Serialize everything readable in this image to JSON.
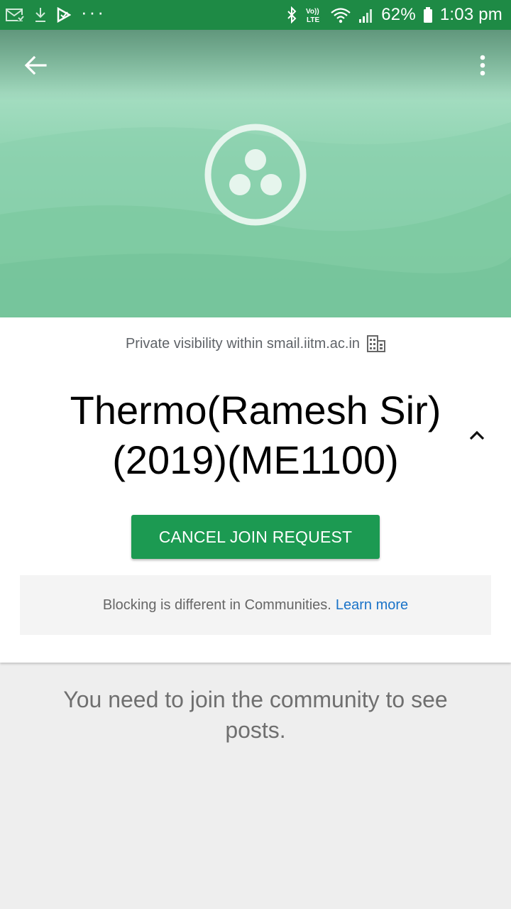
{
  "status_bar": {
    "battery": "62%",
    "time": "1:03 pm",
    "network_label": "Vo)) LTE",
    "left_icons": [
      "mail-icon",
      "download-icon",
      "play-store-icon",
      "more-notifications-icon"
    ],
    "right_icons": [
      "bluetooth-icon",
      "volte-icon",
      "wifi-icon",
      "signal-icon",
      "battery-icon"
    ]
  },
  "header": {
    "back_icon": "arrow-back-icon",
    "menu_icon": "more-vert-icon",
    "logo_icon": "community-icon"
  },
  "community": {
    "visibility_text": "Private visibility within smail.iitm.ac.in",
    "visibility_icon": "domain-building-icon",
    "title_line1": "Thermo(Ramesh Sir)",
    "title_line2": "(2019)(ME1100)",
    "collapse_icon": "chevron-up-icon",
    "cancel_button_label": "CANCEL JOIN REQUEST",
    "notice_text": "Blocking is different in Communities.",
    "learn_more_label": "Learn more"
  },
  "posts_area": {
    "message": "You need to join the community to see posts."
  },
  "colors": {
    "status_bar": "#1e8a45",
    "header_green": "#86d1ac",
    "button_green": "#1c9a52",
    "link_blue": "#1a73c8",
    "background_grey": "#eeeeee"
  }
}
